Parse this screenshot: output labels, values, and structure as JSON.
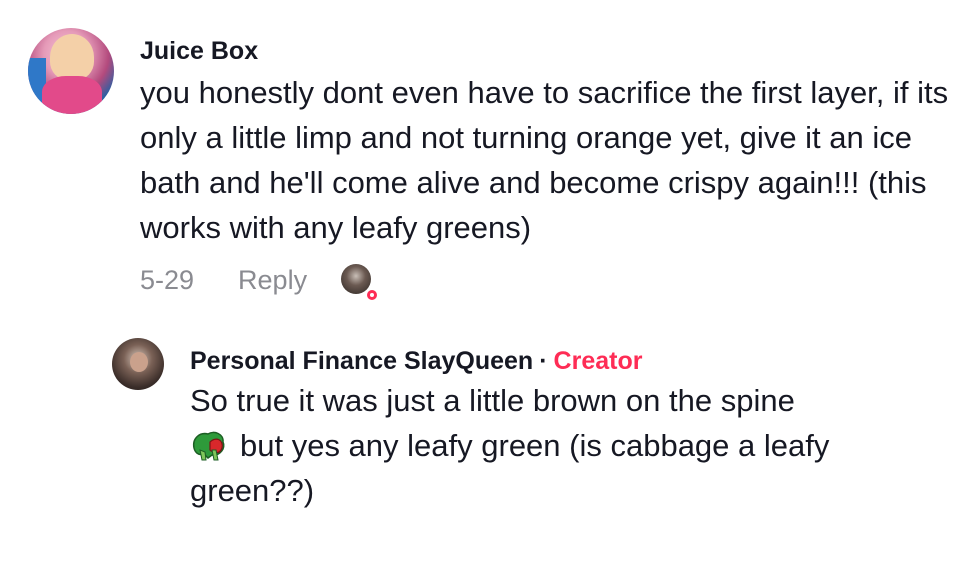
{
  "comment": {
    "author": "Juice Box",
    "text": "you honestly dont even have to sacrifice the first layer, if its only a little limp and not turning orange yet, give it an ice bath and he'll come alive and become crispy again!!! (this works with any leafy greens)",
    "date": "5-29",
    "reply_label": "Reply",
    "liked_by_creator_icon": "creator-liked-avatar-icon"
  },
  "reply": {
    "author": "Personal Finance SlayQueen",
    "separator": "·",
    "badge": "Creator",
    "text_part1": "So true it was just a little brown on the spine",
    "emoji_icon": "lettuce-icon",
    "text_part2": "but yes any leafy green (is cabbage a leafy green??)"
  },
  "colors": {
    "text": "#161823",
    "muted": "#8a8b91",
    "creator_badge": "#fe2c55",
    "background": "#ffffff"
  }
}
